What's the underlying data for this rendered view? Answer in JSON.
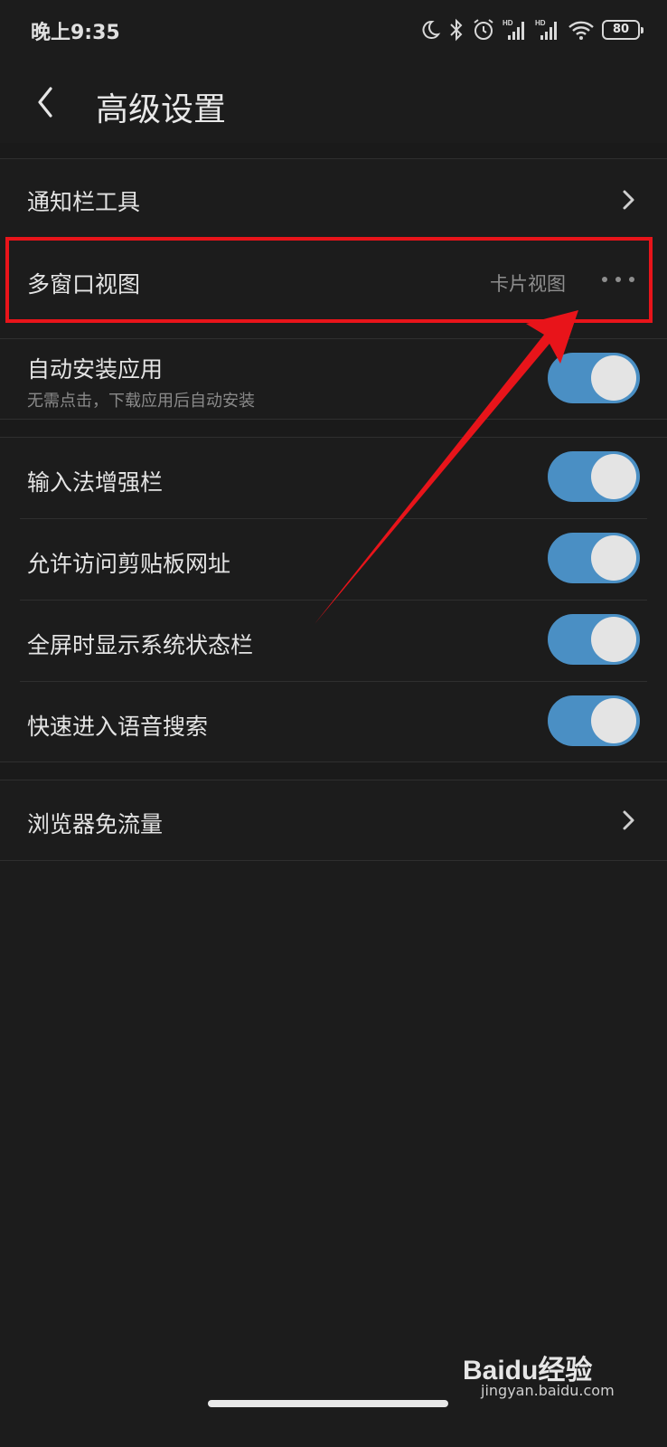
{
  "status_bar": {
    "time": "晚上9:35",
    "battery": "80",
    "icons": [
      "moon-icon",
      "bluetooth-icon",
      "alarm-icon",
      "signal-hd-icon",
      "signal-hd-icon",
      "wifi-icon",
      "battery-icon"
    ]
  },
  "header": {
    "title": "高级设置",
    "back_icon": "chevron-left-icon"
  },
  "settings": {
    "notification_tools": {
      "label": "通知栏工具"
    },
    "multi_window": {
      "label": "多窗口视图",
      "value": "卡片视图"
    },
    "auto_install": {
      "label": "自动安装应用",
      "description": "无需点击，下载应用后自动安装",
      "enabled": true
    },
    "input_bar": {
      "label": "输入法增强栏",
      "enabled": true
    },
    "clipboard_url": {
      "label": "允许访问剪贴板网址",
      "enabled": true
    },
    "fullscreen_statusbar": {
      "label": "全屏时显示系统状态栏",
      "enabled": true
    },
    "voice_search": {
      "label": "快速进入语音搜索",
      "enabled": true
    },
    "data_free": {
      "label": "浏览器免流量"
    }
  },
  "colors": {
    "background": "#1c1c1c",
    "toggle_on": "#4a8fc4",
    "annotation_red": "#e8141a"
  },
  "watermark": {
    "logo_text": "Baidu经验",
    "url": "jingyan.baidu.com"
  }
}
